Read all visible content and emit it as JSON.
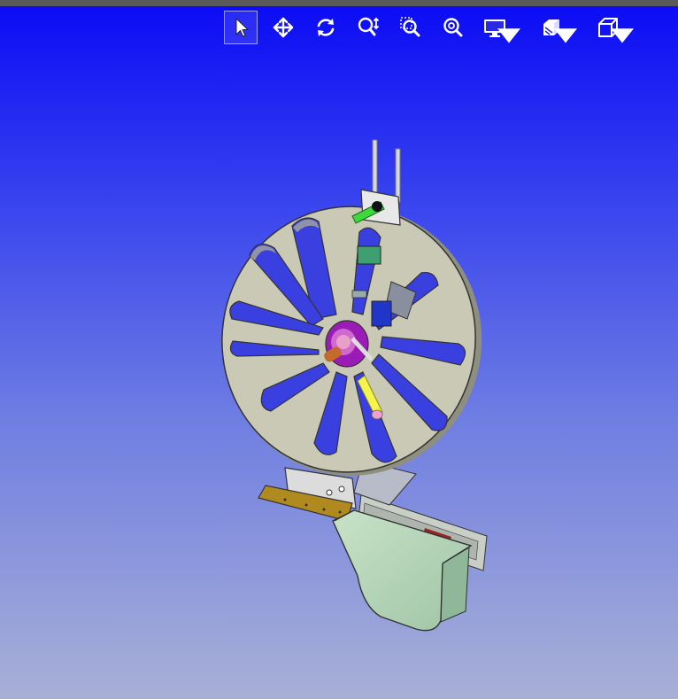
{
  "app": {
    "view": "3D model viewer"
  },
  "toolbar": {
    "buttons": [
      {
        "id": "select",
        "icon": "cursor-icon",
        "active": true
      },
      {
        "id": "pan",
        "icon": "move-arrows-icon",
        "active": false
      },
      {
        "id": "rotate",
        "icon": "rotate-icon",
        "active": false
      },
      {
        "id": "zoom",
        "icon": "zoom-updown-icon",
        "active": false
      },
      {
        "id": "zoom-box",
        "icon": "zoom-window-icon",
        "active": false
      },
      {
        "id": "zoom-fit",
        "icon": "zoom-fit-icon",
        "active": false
      },
      {
        "id": "display",
        "icon": "monitor-icon",
        "dropdown": true
      },
      {
        "id": "sections",
        "icon": "section-cube-icon",
        "dropdown": true
      },
      {
        "id": "views",
        "icon": "cube-view-icon",
        "dropdown": true
      }
    ]
  },
  "colors": {
    "background_top": "#0a0af5",
    "background_bottom": "#a8b0d6",
    "reel": "#c8c8b4",
    "hub": "#9a1bb5",
    "bracket": "#b08a1e",
    "chute": "#b4d2b4"
  }
}
